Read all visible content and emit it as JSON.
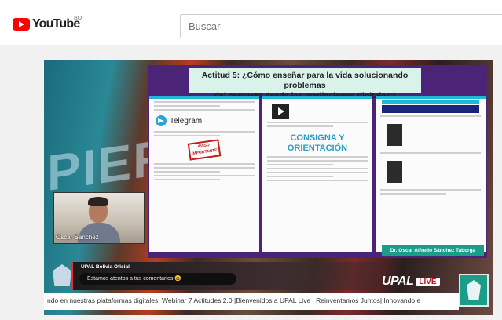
{
  "header": {
    "logo_text": "YouTube",
    "country_code": "BO",
    "search_placeholder": "Buscar"
  },
  "video": {
    "slide_title_line1": "Actitud 5: ¿Cómo enseñar para la vida solucionando problemas",
    "slide_title_line2": "del contexto desde las mediaciones digitales?",
    "telegram_label": "Telegram",
    "stamp_text": "AVISO IMPORTANTE",
    "consigna_line1": "CONSIGNA Y",
    "consigna_line2": "ORIENTACIÓN",
    "presenter_banner": "Dr. Oscar Alfredo Sánchez Taborga",
    "webcam_name": "Oscar Sanchez",
    "comment_user": "UPAL Bolivia Oficial",
    "comment_text": "Estamos atentos a tus comentarios 😀",
    "brand": "UPAL",
    "live_label": "LIVE",
    "ticker": "ndo en nuestras plataformas digitales! Webinar 7 Actitudes 2.0 |Bienvenidos a UPAL Live | Reinventamos Juntos| Innovando e"
  },
  "colors": {
    "youtube_red": "#ff0000",
    "slide_purple": "#4b2377",
    "accent_cyan": "#1fb8d6",
    "teal": "#1a9e8a",
    "comment_red": "#ea2b30"
  }
}
